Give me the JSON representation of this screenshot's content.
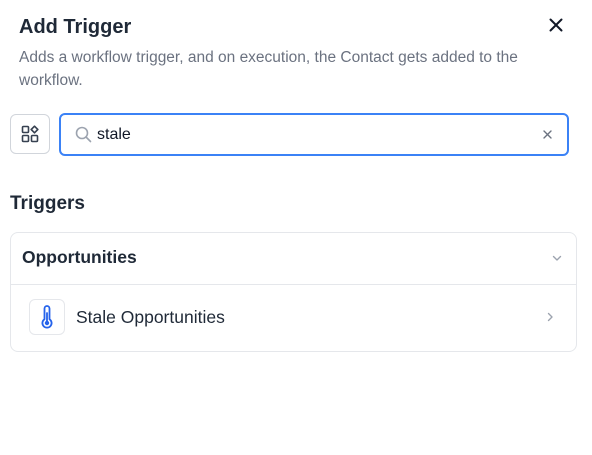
{
  "header": {
    "title": "Add Trigger",
    "description": "Adds a workflow trigger, and on execution, the Contact gets added to the workflow."
  },
  "search": {
    "value": "stale",
    "placeholder": ""
  },
  "section": {
    "heading": "Triggers"
  },
  "groups": [
    {
      "title": "Opportunities",
      "items": [
        {
          "label": "Stale Opportunities",
          "icon": "thermometer-icon"
        }
      ]
    }
  ],
  "colors": {
    "accent": "#3b82f6",
    "text": "#1f2937",
    "muted": "#6b7280",
    "border": "#e5e7eb"
  }
}
